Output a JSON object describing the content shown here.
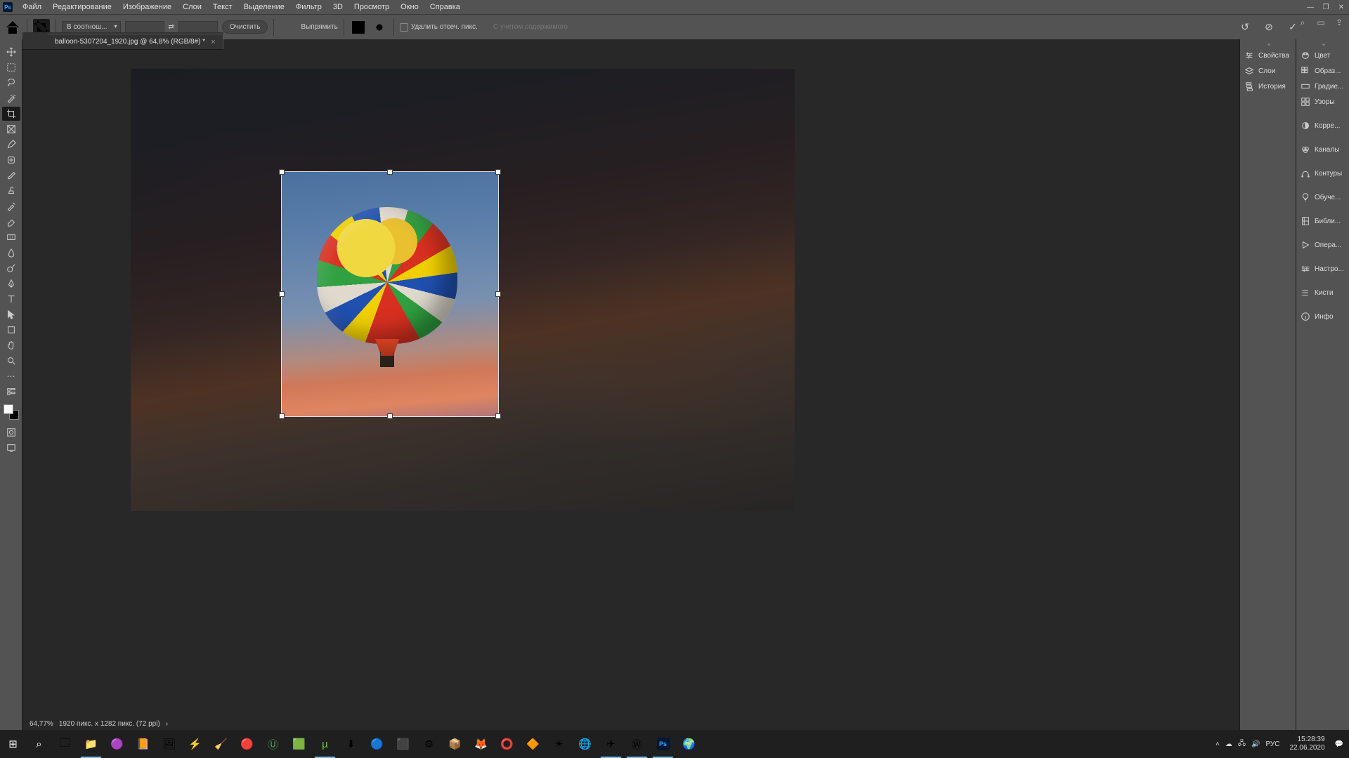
{
  "menu": {
    "items": [
      "Файл",
      "Редактирование",
      "Изображение",
      "Слои",
      "Текст",
      "Выделение",
      "Фильтр",
      "3D",
      "Просмотр",
      "Окно",
      "Справка"
    ]
  },
  "options": {
    "ratio_mode": "В соотнош...",
    "clear": "Очистить",
    "straighten": "Выпрямить",
    "delete_px": "Удалить отсеч. пикс.",
    "content_aware": "С учетом содержимого"
  },
  "tab": {
    "title": "balloon-5307204_1920.jpg @ 64,8% (RGB/8#) *"
  },
  "panels_a": [
    "Свойства",
    "Слои",
    "История"
  ],
  "panels_b": [
    "Цвет",
    "Образ...",
    "Градие...",
    "Узоры",
    "Корре...",
    "Каналы",
    "Контуры",
    "Обуче...",
    "Библи...",
    "Опера...",
    "Настро...",
    "Кисти",
    "Инфо"
  ],
  "status": {
    "zoom": "64,77%",
    "dims": "1920 пикс. x 1282 пикс. (72 ppi)"
  },
  "clock": {
    "time": "15:28:39",
    "date": "22.06.2020",
    "lang": "РУС"
  }
}
